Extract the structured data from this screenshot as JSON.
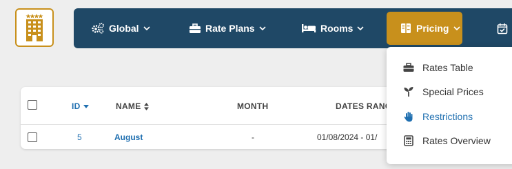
{
  "nav": {
    "global": "Global",
    "rate_plans": "Rate Plans",
    "rooms": "Rooms",
    "pricing": "Pricing",
    "accent_color": "#c8901c",
    "bar_color": "#1f4866"
  },
  "pricing_menu": {
    "items": [
      {
        "label": "Rates Table",
        "icon": "briefcase-icon"
      },
      {
        "label": "Special Prices",
        "icon": "sprout-icon"
      },
      {
        "label": "Restrictions",
        "icon": "hand-icon"
      },
      {
        "label": "Rates Overview",
        "icon": "calculator-icon"
      }
    ],
    "active_color": "#1f6fb0"
  },
  "table": {
    "headers": {
      "id": "ID",
      "name": "NAME",
      "month": "MONTH",
      "dates": "DATES RANG"
    },
    "rows": [
      {
        "id": "5",
        "name": "August",
        "month": "-",
        "dates": "01/08/2024 - 01/"
      }
    ]
  }
}
